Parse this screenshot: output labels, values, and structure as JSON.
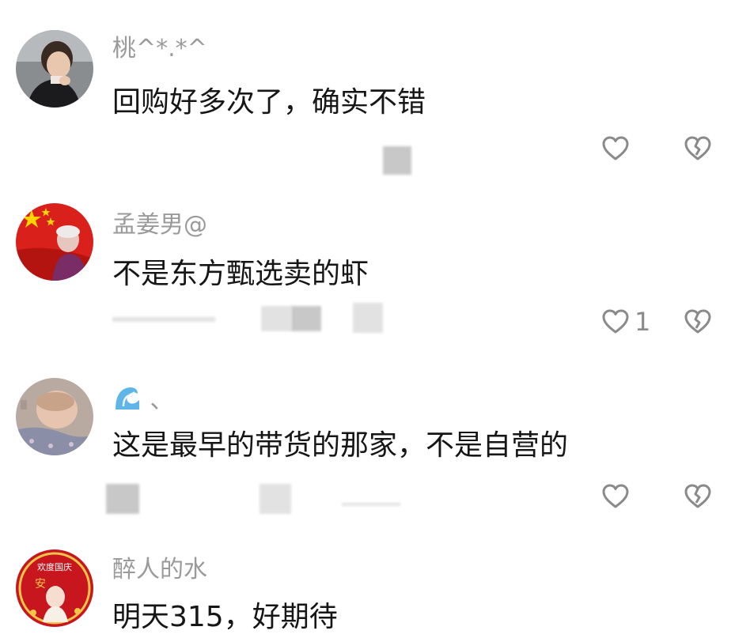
{
  "comments": [
    {
      "username": "桃^*.*^",
      "text": "回购好多次了，确实不错",
      "like_count": "",
      "avatar_icon": "girl-portrait-avatar"
    },
    {
      "username": "孟姜男@",
      "text": "不是东方甄选卖的虾",
      "like_count": "1",
      "avatar_icon": "red-flag-avatar"
    },
    {
      "username": "、",
      "username_icon": "wave-emoji-icon",
      "text": "这是最早的带货的那家，不是自营的",
      "like_count": "",
      "avatar_icon": "baby-photo-avatar"
    },
    {
      "username": "醉人的水",
      "text": "明天315，好期待",
      "like_count": "",
      "avatar_icon": "national-day-badge-avatar",
      "avatar_text": "欢度国庆",
      "avatar_subtext": "安"
    }
  ],
  "colors": {
    "username": "#9a9a9a",
    "text": "#161616",
    "icon": "#8a8a8a"
  }
}
